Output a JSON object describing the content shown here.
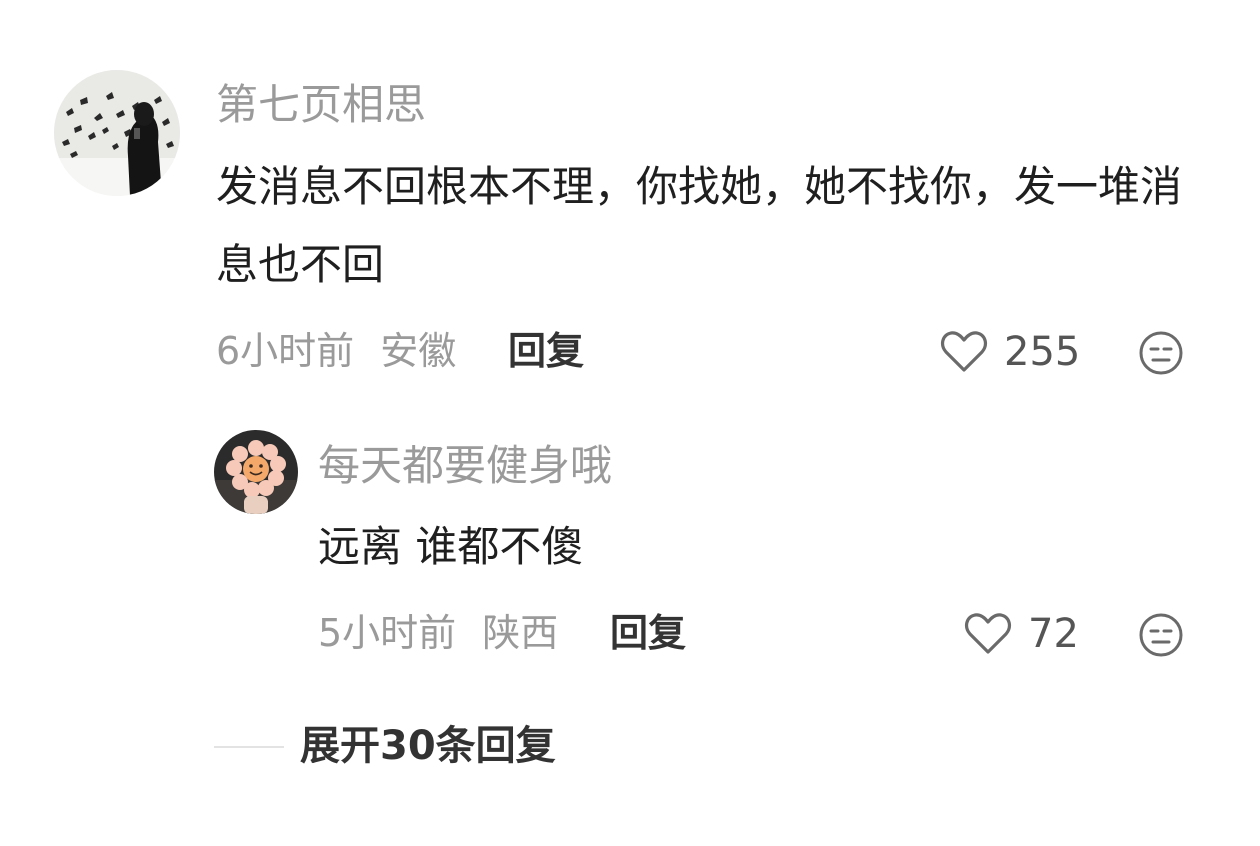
{
  "comments": [
    {
      "username": "第七页相思",
      "text": "发消息不回根本不理，你找她，她不找你，发一堆消息也不回",
      "time": "6小时前",
      "location": "安徽",
      "reply_label": "回复",
      "likes": "255",
      "icons": {
        "like": "heart-outline-icon",
        "dislike": "meh-face-icon"
      },
      "avatar": "avatar-woman-butterflies"
    },
    {
      "username": "每天都要健身哦",
      "text": "远离 谁都不傻",
      "time": "5小时前",
      "location": "陕西",
      "reply_label": "回复",
      "likes": "72",
      "icons": {
        "like": "heart-outline-icon",
        "dislike": "meh-face-icon"
      },
      "avatar": "avatar-sunflower-toy"
    }
  ],
  "expand_replies": {
    "label": "展开30条回复"
  },
  "colors": {
    "secondary_text": "#9a9a9a",
    "primary_text": "#1f1f1f",
    "icon": "#6a6a6a"
  }
}
